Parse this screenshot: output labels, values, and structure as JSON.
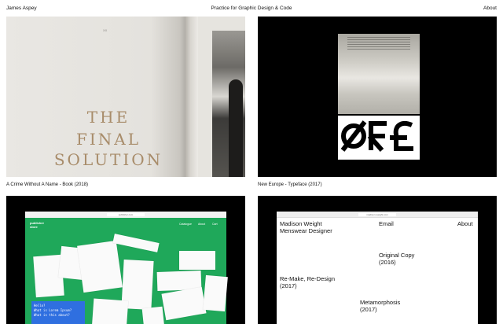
{
  "header": {
    "site_name": "James Aspey",
    "tagline": "Practice for Graphic Design & Code",
    "about_link": "About"
  },
  "projects": [
    {
      "caption": "A Crime Without A Name - Book (2018)",
      "book": {
        "folio": "XX",
        "title_lines": [
          "THE",
          "FINAL",
          "SOLUTION"
        ]
      }
    },
    {
      "caption": "New Europe - Typeface (2017)",
      "glyphs": "ØÆ£"
    },
    {
      "caption": "",
      "site": {
        "url": "publisher.com",
        "logo_lines": [
          "publisher",
          "store"
        ],
        "nav": [
          "Catalogue",
          "About",
          "Cart"
        ],
        "prompt_lines": [
          "Hello?",
          "What is Lorem Ipsum?",
          "What is this about?"
        ]
      }
    },
    {
      "caption": "",
      "site": {
        "url": "madison-weight.com",
        "name_lines": [
          "Madison Weight",
          "Menswear Designer"
        ],
        "email": "Email",
        "about": "About",
        "items": [
          {
            "title": "Original Copy",
            "year": "(2016)"
          },
          {
            "title": "Re-Make, Re-Design",
            "year": "(2017)"
          },
          {
            "title": "Metamorphosis",
            "year": "(2017)"
          }
        ]
      }
    }
  ],
  "colors": {
    "accent_green": "#1fa85a",
    "accent_blue": "#2f6fe0",
    "book_title": "#a88c6a"
  }
}
